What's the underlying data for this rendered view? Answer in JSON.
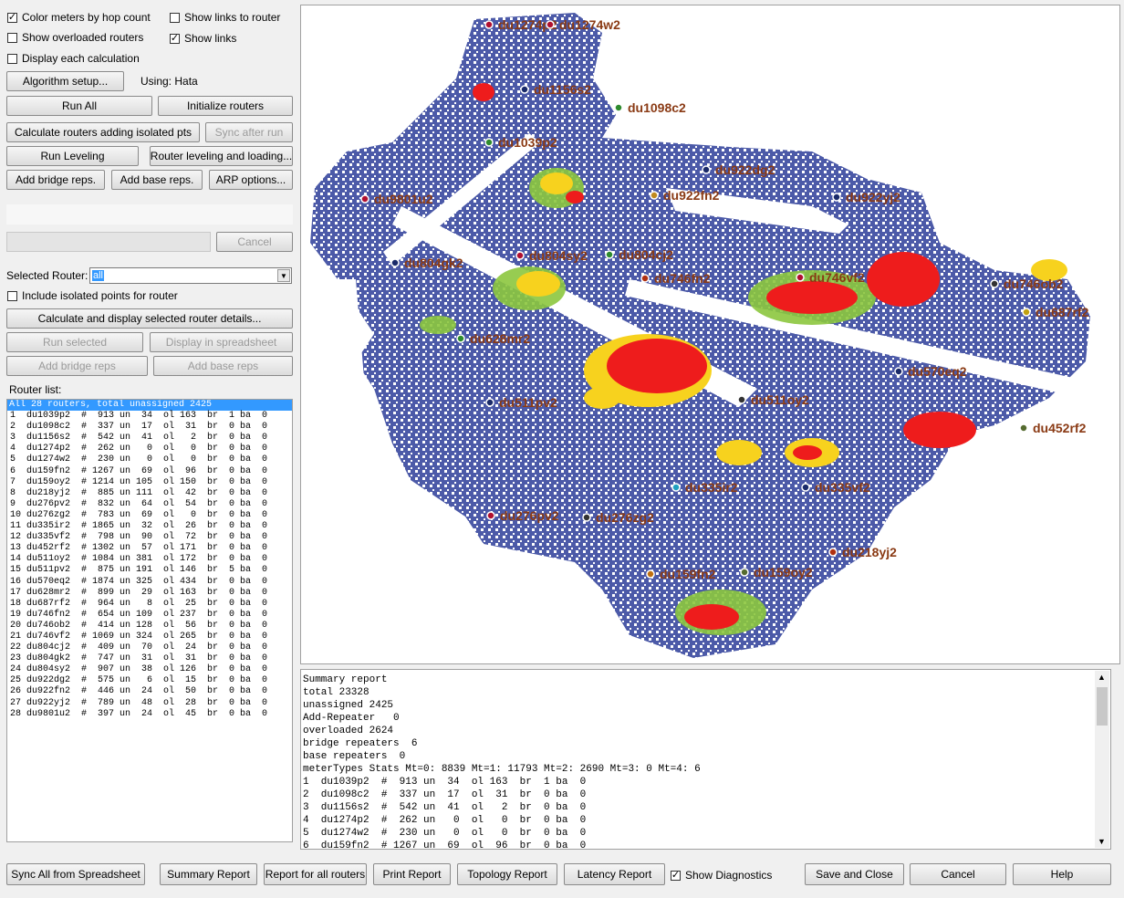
{
  "options": {
    "color_meters": {
      "label": "Color meters by hop count",
      "checked": true
    },
    "show_overloaded": {
      "label": "Show overloaded routers",
      "checked": false
    },
    "display_each": {
      "label": "Display each calculation",
      "checked": false
    },
    "show_links_router": {
      "label": "Show links to router",
      "checked": false
    },
    "show_links": {
      "label": "Show links",
      "checked": true
    }
  },
  "buttons": {
    "algorithm_setup": "Algorithm setup...",
    "using": "Using: Hata",
    "run_all": "Run All",
    "initialize_routers": "Initialize routers",
    "calc_isolated": "Calculate routers adding isolated pts",
    "sync_after_run": "Sync after run",
    "run_leveling": "Run Leveling",
    "router_leveling": "Router leveling and loading...",
    "add_bridge": "Add bridge reps.",
    "add_base": "Add base reps.",
    "arp_options": "ARP options...",
    "cancel_progress": "Cancel",
    "calc_display_details": "Calculate and display selected router details...",
    "run_selected": "Run selected",
    "display_spreadsheet": "Display in spreadsheet",
    "add_bridge_reps": "Add bridge reps",
    "add_base_reps": "Add base reps"
  },
  "selected_router": {
    "label": "Selected Router:",
    "value": "all"
  },
  "include_isolated": {
    "label": "Include isolated points for router",
    "checked": false
  },
  "router_list": {
    "label": "Router list:",
    "header": "All 28 routers, total unassigned 2425",
    "rows": [
      "1  du1039p2  #  913 un  34  ol 163  br  1 ba  0",
      "2  du1098c2  #  337 un  17  ol  31  br  0 ba  0",
      "3  du1156s2  #  542 un  41  ol   2  br  0 ba  0",
      "4  du1274p2  #  262 un   0  ol   0  br  0 ba  0",
      "5  du1274w2  #  230 un   0  ol   0  br  0 ba  0",
      "6  du159fn2  # 1267 un  69  ol  96  br  0 ba  0",
      "7  du159oy2  # 1214 un 105  ol 150  br  0 ba  0",
      "8  du218yj2  #  885 un 111  ol  42  br  0 ba  0",
      "9  du276pv2  #  832 un  64  ol  54  br  0 ba  0",
      "10 du276zg2  #  783 un  69  ol   0  br  0 ba  0",
      "11 du335ir2  # 1865 un  32  ol  26  br  0 ba  0",
      "12 du335vf2  #  798 un  90  ol  72  br  0 ba  0",
      "13 du452rf2  # 1302 un  57  ol 171  br  0 ba  0",
      "14 du511oy2  # 1084 un 381  ol 172  br  0 ba  0",
      "15 du511pv2  #  875 un 191  ol 146  br  5 ba  0",
      "16 du570eq2  # 1874 un 325  ol 434  br  0 ba  0",
      "17 du628mr2  #  899 un  29  ol 163  br  0 ba  0",
      "18 du687rf2  #  964 un   8  ol  25  br  0 ba  0",
      "19 du746fn2  #  654 un 109  ol 237  br  0 ba  0",
      "20 du746ob2  #  414 un 128  ol  56  br  0 ba  0",
      "21 du746vf2  # 1069 un 324  ol 265  br  0 ba  0",
      "22 du804cj2  #  409 un  70  ol  24  br  0 ba  0",
      "23 du804gk2  #  747 un  31  ol  31  br  0 ba  0",
      "24 du804sy2  #  907 un  38  ol 126  br  0 ba  0",
      "25 du922dg2  #  575 un   6  ol  15  br  0 ba  0",
      "26 du922fn2  #  446 un  24  ol  50  br  0 ba  0",
      "27 du922yj2  #  789 un  48  ol  28  br  0 ba  0",
      "28 du9801u2  #  397 un  24  ol  45  br  0 ba  0"
    ]
  },
  "summary": {
    "lines": [
      "Summary report",
      "total 23328",
      "unassigned 2425",
      "Add-Repeater   0",
      "overloaded 2624",
      "bridge repeaters  6",
      "base repeaters  0",
      "meterTypes Stats Mt=0: 8839 Mt=1: 11793 Mt=2: 2690 Mt=3: 0 Mt=4: 6",
      "1  du1039p2  #  913 un  34  ol 163  br  1 ba  0",
      "2  du1098c2  #  337 un  17  ol  31  br  0 ba  0",
      "3  du1156s2  #  542 un  41  ol   2  br  0 ba  0",
      "4  du1274p2  #  262 un   0  ol   0  br  0 ba  0",
      "5  du1274w2  #  230 un   0  ol   0  br  0 ba  0",
      "6  du159fn2  # 1267 un  69  ol  96  br  0 ba  0"
    ]
  },
  "bottom": {
    "sync_all": "Sync All from Spreadsheet",
    "summary_report": "Summary Report",
    "report_all": "Report for all routers",
    "print_report": "Print Report",
    "topology_report": "Topology Report",
    "latency_report": "Latency Report",
    "show_diagnostics": {
      "label": "Show Diagnostics",
      "checked": true
    },
    "save_close": "Save and Close",
    "cancel": "Cancel",
    "help": "Help"
  },
  "map": {
    "colors": {
      "mesh": "#4c5aa8",
      "hot": "#ee1c1c",
      "warm": "#f7d21e",
      "mid": "#8cc63e",
      "label": "#8a3a14"
    },
    "routers": [
      {
        "name": "du1274p2",
        "marker": "#b01030"
      },
      {
        "name": "du1274w2",
        "marker": "#b01030"
      },
      {
        "name": "du1156s2",
        "marker": "#1a2a6a"
      },
      {
        "name": "du1098c2",
        "marker": "#2e8b2e"
      },
      {
        "name": "du1039p2",
        "marker": "#2e8b2e"
      },
      {
        "name": "du9801u2",
        "marker": "#b01030"
      },
      {
        "name": "du922fn2",
        "marker": "#c08a20"
      },
      {
        "name": "du922yj2",
        "marker": "#1a2a6a"
      },
      {
        "name": "du922dg2",
        "marker": "#1a2a6a"
      },
      {
        "name": "du804gk2",
        "marker": "#1a2a6a"
      },
      {
        "name": "du804sy2",
        "marker": "#b01030"
      },
      {
        "name": "du804cj2",
        "marker": "#2e8b2e"
      },
      {
        "name": "du746fn2",
        "marker": "#b03010"
      },
      {
        "name": "du746vf2",
        "marker": "#b01030"
      },
      {
        "name": "du746ob2",
        "marker": "#333333"
      },
      {
        "name": "du687rf2",
        "marker": "#c0a010"
      },
      {
        "name": "du628mr2",
        "marker": "#2e8b2e"
      },
      {
        "name": "du570eq2",
        "marker": "#1a2a6a"
      },
      {
        "name": "du511pv2",
        "marker": "#1a2a6a"
      },
      {
        "name": "du511oy2",
        "marker": "#333333"
      },
      {
        "name": "du452rf2",
        "marker": "#556b2f"
      },
      {
        "name": "du335ir2",
        "marker": "#20a0c0"
      },
      {
        "name": "du335vf2",
        "marker": "#1a2a6a"
      },
      {
        "name": "du276pv2",
        "marker": "#b01030"
      },
      {
        "name": "du276zg2",
        "marker": "#333333"
      },
      {
        "name": "du218yj2",
        "marker": "#b03010"
      },
      {
        "name": "du159fn2",
        "marker": "#c07010"
      },
      {
        "name": "du159oy2",
        "marker": "#556b2f"
      }
    ]
  }
}
